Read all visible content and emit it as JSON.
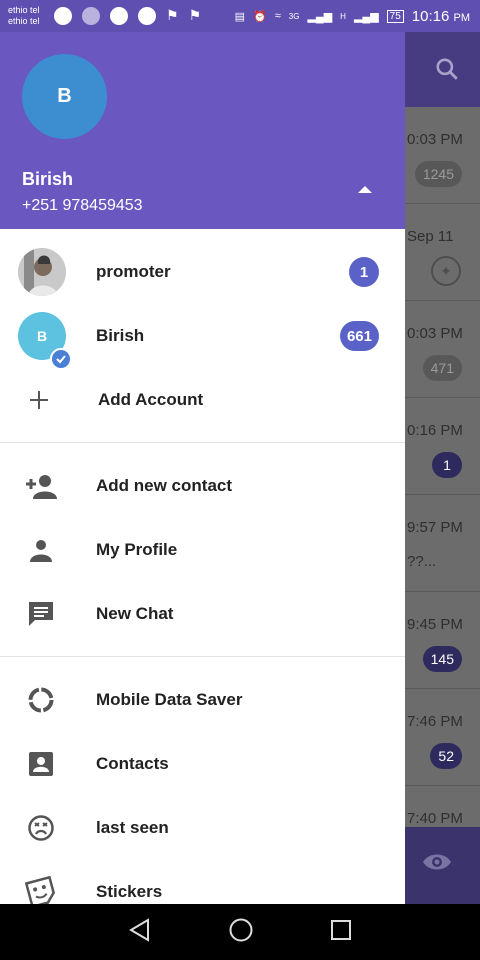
{
  "status_bar": {
    "carrier_1": "ethio tel",
    "carrier_2": "ethio tel",
    "network_1": "3G",
    "network_2": "H",
    "battery": "75",
    "time": "10:16",
    "ampm": "PM"
  },
  "background_list": {
    "rows": [
      {
        "time": "0:03 PM",
        "badge": "1245"
      },
      {
        "time": "Sep 11",
        "badge": ""
      },
      {
        "time": "0:03 PM",
        "badge": "471"
      },
      {
        "time": "0:16 PM",
        "badge": "1"
      },
      {
        "time": "9:57 PM",
        "preview": "??..."
      },
      {
        "time": "9:45 PM",
        "badge": "145"
      },
      {
        "time": "7:46 PM",
        "badge": "52"
      },
      {
        "time": "7:40 PM"
      }
    ]
  },
  "drawer": {
    "avatar_letter": "B",
    "user_name": "Birish",
    "user_phone": "+251 978459453",
    "accounts": [
      {
        "label": "promoter",
        "badge": "1"
      },
      {
        "label": "Birish",
        "badge": "661",
        "avatar_letter": "B"
      }
    ],
    "add_account_label": "Add Account",
    "menu": [
      {
        "label": "Add new contact",
        "icon": "add-person-icon"
      },
      {
        "label": "My Profile",
        "icon": "person-icon"
      },
      {
        "label": "New Chat",
        "icon": "chat-icon"
      },
      {
        "label": "Mobile Data Saver",
        "icon": "data-saver-icon"
      },
      {
        "label": "Contacts",
        "icon": "contacts-icon"
      },
      {
        "label": "last seen",
        "icon": "sad-face-icon"
      },
      {
        "label": "Stickers",
        "icon": "sticker-icon"
      }
    ]
  },
  "colors": {
    "header": "#6a58c0",
    "status_bar": "#5e4fb0",
    "badge": "#5a62c8",
    "avatar": "#3d8ed0"
  }
}
